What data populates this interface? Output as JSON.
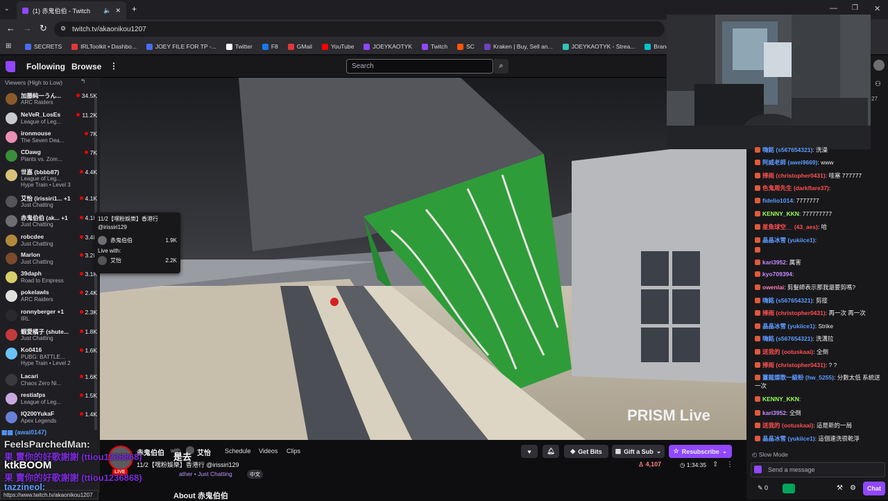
{
  "browser": {
    "tab_title": "(1) 赤鬼伯伯 - Twitch",
    "url": "twitch.tv/akaonikou1207",
    "bookmarks": [
      {
        "label": "SECRETS",
        "color": "#4a6cf7"
      },
      {
        "label": "IRLToolkit • Dashbo...",
        "color": "#e23838"
      },
      {
        "label": "JOEY FILE FOR TP -...",
        "color": "#4a6cf7"
      },
      {
        "label": "Twitter",
        "color": "#ffffff"
      },
      {
        "label": "F8",
        "color": "#1877f2"
      },
      {
        "label": "GMail",
        "color": "#e23838"
      },
      {
        "label": "YouTube",
        "color": "#ff0000"
      },
      {
        "label": "JOEYKAOTYK",
        "color": "#9147ff"
      },
      {
        "label": "Twitch",
        "color": "#9147ff"
      },
      {
        "label": "SC",
        "color": "#ff5500"
      },
      {
        "label": "Kraken | Buy, Sell an...",
        "color": "#6f42c1"
      },
      {
        "label": "JOEYKAOTYK - Strea...",
        "color": "#2ec4b6"
      },
      {
        "label": "Brand Kit - Canva",
        "color": "#00c4cc"
      },
      {
        "label": "me",
        "color": "#aaaaaa"
      }
    ],
    "bookmarks_more": "arks",
    "status_url": "https://www.twitch.tv/akaonikou1207"
  },
  "nav": {
    "following": "Following",
    "browse": "Browse",
    "more": "⋮",
    "search_placeholder": "Search"
  },
  "sidebar": {
    "sort_label": "Viewers (High to Low)",
    "channels": [
      {
        "name": "加藤純一うん...",
        "game": "ARC Raiders",
        "viewers": "34.5K",
        "color": "#8b5a2b"
      },
      {
        "name": "NeVeR_LosEs",
        "game": "League of Leg...",
        "viewers": "11.2K",
        "color": "#c9c9d0"
      },
      {
        "name": "ironmouse",
        "game": "The Seven Dea...",
        "viewers": "7K",
        "color": "#e98fb3"
      },
      {
        "name": "CDawg",
        "game": "Plants vs. Zom...",
        "viewers": "7K",
        "color": "#3a8d3a"
      },
      {
        "name": "世嘉 (bbbb87)",
        "game": "League of Leg...",
        "viewers": "4.4K",
        "color": "#d8c27a",
        "hype": "Hype Train • Level 3"
      },
      {
        "name": "艾怡 (irissiri1... +1",
        "game": "Just Chatting",
        "viewers": "4.1K",
        "color": "#555558"
      },
      {
        "name": "赤鬼伯伯 (ak... +1",
        "game": "Just Chatting",
        "viewers": "4.1K",
        "color": "#6d6d72"
      },
      {
        "name": "robcdee",
        "game": "Just Chatting",
        "viewers": "3.4K",
        "color": "#b08a3a"
      },
      {
        "name": "Marlon",
        "game": "Just Chatting",
        "viewers": "3.2K",
        "color": "#7a4a2b"
      },
      {
        "name": "39daph",
        "game": "Road to Empress",
        "viewers": "3.1K",
        "color": "#d9d06a"
      },
      {
        "name": "pokelawls",
        "game": "ARC Raiders",
        "viewers": "2.4K",
        "color": "#e0e0e0"
      },
      {
        "name": "ronnyberger +1",
        "game": "IRL",
        "viewers": "2.3K",
        "color": "#2a2a2e"
      },
      {
        "name": "蝦愛橘子 (shute...",
        "game": "Just Chatting",
        "viewers": "1.8K",
        "color": "#c23a3a"
      },
      {
        "name": "Ko0416",
        "game": "PUBG: BATTLE...",
        "viewers": "1.6K",
        "color": "#6ac3ff",
        "hype": "Hype Train • Level 2"
      },
      {
        "name": "Lacari",
        "game": "Chaos Zero Ni...",
        "viewers": "1.6K",
        "color": "#3a3a3e"
      },
      {
        "name": "restiafps",
        "game": "League of Leg...",
        "viewers": "1.5K",
        "color": "#c9a7e0"
      },
      {
        "name": "IQ200YukaF",
        "game": "Apex Legends",
        "viewers": "1.4K",
        "color": "#6b7fd7"
      }
    ]
  },
  "tooltip": {
    "title": "11/2【嘿粉娛樂】香港行",
    "handle": "@irissiri129",
    "host_name": "赤鬼伯伯",
    "host_viewers": "1.9K",
    "live_with": "Live with:",
    "guest_name": "艾怡",
    "guest_viewers": "2.2K"
  },
  "video": {
    "watermark": "PRISM Live"
  },
  "stream": {
    "channel": "赤鬼伯伯",
    "with": "with",
    "guest": "艾怡",
    "title": "11/2【嘿粉娛樂】香港行 @irissiri129",
    "category_prefix": "ather • Just Chatting",
    "lang": "中文",
    "tabs": [
      "Schedule",
      "Videos",
      "Clips"
    ],
    "get_bits": "Get Bits",
    "gift_sub": "Gift a Sub",
    "resubscribe": "Resubscribe",
    "viewers": "4,107",
    "uptime": "1:34:35",
    "about": "About 赤鬼伯伯",
    "live": "LIVE"
  },
  "chat": {
    "messages": [
      {
        "user": "嗨銘 (s567654321)",
        "text": "洗澡",
        "color": "#5b9bff"
      },
      {
        "user": "阿威老師 (awei9669)",
        "text": "www",
        "color": "#5b9bff"
      },
      {
        "user": "掃雨 (christopher0431)",
        "text": "哇塞 777777",
        "color": "#ff4f4f"
      },
      {
        "user": "色鬼周先生 (darkflare37)",
        "text": "",
        "color": "#ff4f4f"
      },
      {
        "user": "fidelio1014",
        "text": "7777777",
        "color": "#5b9bff"
      },
      {
        "user": "KENNY_KKN",
        "text": "777777777",
        "color": "#9aff4f"
      },
      {
        "user": "星魚球空__ (43_aes)",
        "text": "哈",
        "color": "#ff4f4f"
      },
      {
        "user": "晶晶冰雪 (yukiice1)",
        "text": "",
        "color": "#5b9bff"
      },
      {
        "user": "",
        "text": "",
        "color": "#5b9bff"
      },
      {
        "user": "kari3952",
        "text": "厲害",
        "color": "#c58aff"
      },
      {
        "user": "kyo709394",
        "text": "",
        "color": "#c58aff"
      },
      {
        "user": "owenlai",
        "text": "剪髮師表示那我還要剪嗎?",
        "color": "#ff7fb0"
      },
      {
        "user": "嗨銘 (s567654321)",
        "text": "剪接",
        "color": "#5b9bff"
      },
      {
        "user": "掃雨 (christopher0431)",
        "text": "再一次 再一次",
        "color": "#ff4f4f"
      },
      {
        "user": "晶晶冰雪 (yukiice1)",
        "text": "Strike",
        "color": "#5b9bff"
      },
      {
        "user": "嗨銘 (s567654321)",
        "text": "洗溝拉",
        "color": "#5b9bff"
      },
      {
        "user": "送我的 (ootuskaai)",
        "text": "全倒",
        "color": "#ff4f4f"
      },
      {
        "user": "掃雨 (christopher0431)",
        "text": "? ?",
        "color": "#ff4f4f"
      },
      {
        "user": "薑懿燦歌一級粉 (hw_5255)",
        "text": "分數太低 系統送一次",
        "color": "#5b9bff"
      },
      {
        "user": "KENNY_KKN",
        "text": "",
        "color": "#9aff4f"
      },
      {
        "user": "kari3952",
        "text": "全倒",
        "color": "#c58aff"
      },
      {
        "user": "送我的 (ootuskaai)",
        "text": "這是新的一局",
        "color": "#ff4f4f"
      },
      {
        "user": "晶晶冰雪 (yukiice1)",
        "text": "這個連洗很乾淨",
        "color": "#5b9bff"
      }
    ],
    "slow_mode": "Slow Mode",
    "send_placeholder": "Send a message",
    "points": "0",
    "chat_button": "Chat",
    "side_count": "27"
  },
  "overlay": {
    "lines": [
      {
        "text": "FeelsParchedMan:",
        "color": "#d9d9d9"
      },
      {
        "text": "果 賣你的好歌謝謝 (ttiou1236868)",
        "color": "#7b2bd9"
      },
      {
        "text": "ktkBOOM",
        "color": "#ffffff"
      },
      {
        "text": "果 賣你的好歌謝謝 (ttiou1236868)",
        "color": "#7b2bd9"
      },
      {
        "text": "tazzineol:",
        "color": "#5b9bff"
      }
    ],
    "extra": "是去"
  },
  "colors": {
    "accent": "#9147ff",
    "live": "#eb0400",
    "bg": "#0e0e10"
  }
}
